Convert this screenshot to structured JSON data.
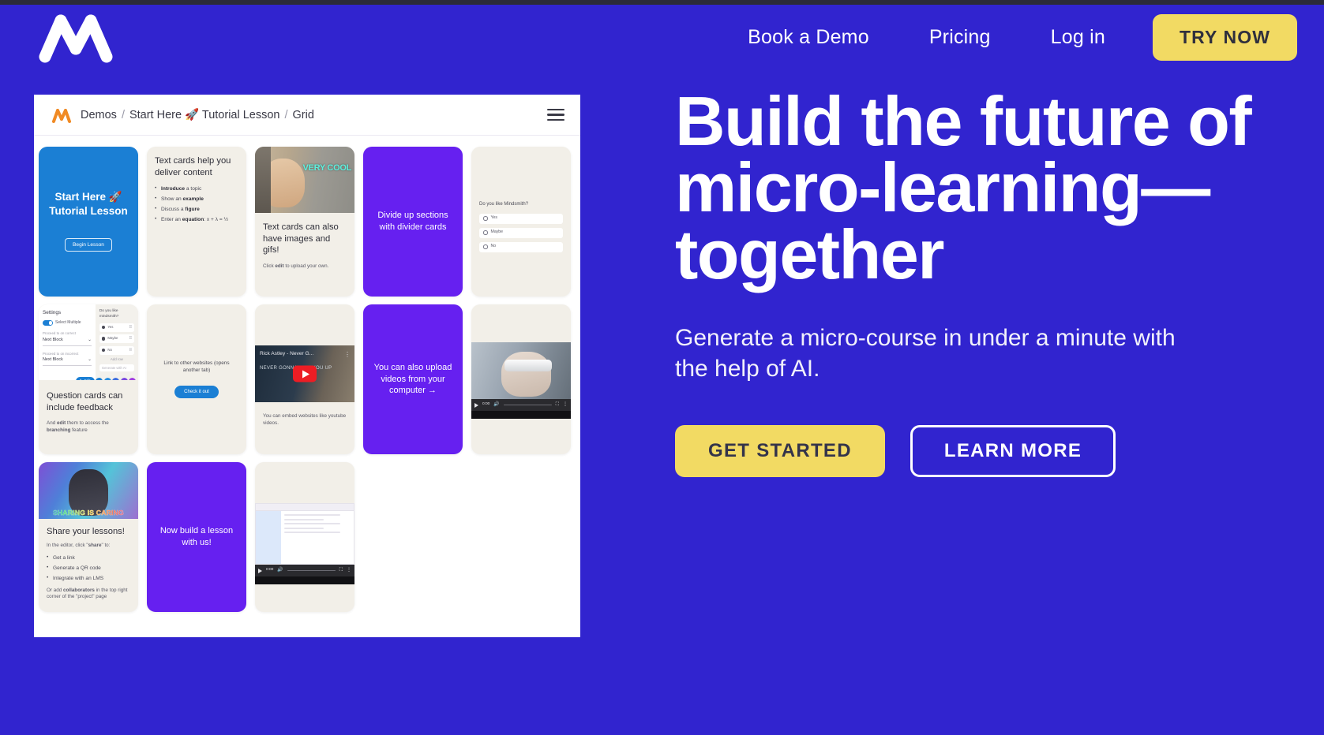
{
  "nav": {
    "logo": "mindsmith-logo",
    "links": [
      {
        "label": "Book a Demo"
      },
      {
        "label": "Pricing"
      },
      {
        "label": "Log in"
      }
    ],
    "cta": "TRY NOW"
  },
  "hero": {
    "title": "Build the future of micro-learning—together",
    "subtitle": "Generate a micro-course in under a minute with the help of AI.",
    "primary_cta": "GET STARTED",
    "secondary_cta": "LEARN MORE"
  },
  "colors": {
    "background": "#3124cf",
    "accent_yellow": "#f2da63",
    "card_purple": "#6620f0",
    "card_blue": "#1b7fd4",
    "card_cream": "#f2efe8",
    "logo_orange": "#f08a24"
  },
  "app": {
    "breadcrumb": {
      "items": [
        "Demos",
        "Start Here 🚀 Tutorial Lesson",
        "Grid"
      ],
      "separator": "/"
    },
    "menu_icon": "hamburger-icon",
    "cards": [
      {
        "id": "start-here",
        "type": "blue",
        "title": "Start Here 🚀 Tutorial Lesson",
        "button": "Begin Lesson"
      },
      {
        "id": "text-cards",
        "type": "text",
        "heading": "Text cards help you deliver content",
        "bullets": [
          {
            "bold": "Introduce",
            "rest": " a topic"
          },
          {
            "pre": "Show an ",
            "bold": "example",
            "rest": ""
          },
          {
            "pre": "Discuss a ",
            "bold": "figure",
            "rest": ""
          },
          {
            "pre": "Enter an ",
            "bold": "equation",
            "rest": ": x + λ = ½"
          }
        ]
      },
      {
        "id": "image-gif-card",
        "type": "image-text",
        "image_caption": "VERY COOL",
        "heading": "Text cards can also have images and gifs!",
        "note_pre": "Click ",
        "note_bold": "edit",
        "note_post": " to upload your own."
      },
      {
        "id": "divider-card",
        "type": "divider",
        "text": "Divide up sections with divider cards"
      },
      {
        "id": "quiz-card",
        "type": "quiz",
        "question": "Do you like Mindsmith?",
        "options": [
          "Yes",
          "Maybe",
          "No"
        ]
      },
      {
        "id": "question-feedback",
        "type": "settings-shot",
        "settings_title": "Settings",
        "toggle_label": "Select Multiple",
        "field1_label": "Proceed to on correct",
        "field1_value": "Next Block",
        "field2_label": "Proceed to on incorrect",
        "field2_value": "Next Block",
        "panel_question": "Do you like mindsmith?",
        "panel_options": [
          "Yes",
          "Maybe",
          "No"
        ],
        "panel_add": "Add row",
        "panel_input": "Generate with AI",
        "toolbar_label": "Edit",
        "heading": "Question cards can include feedback",
        "note_pre": "And ",
        "note_bold": "edit",
        "note_mid": " them to access the ",
        "note_bold2": "branching",
        "note_post": " feature"
      },
      {
        "id": "link-card",
        "type": "link",
        "text": "Link to other websites (opens another tab)",
        "button": "Check it out"
      },
      {
        "id": "youtube-embed",
        "type": "youtube",
        "video_title": "Rick Astley - Never G...",
        "video_overlay": "NEVER GONNA GIVE YOU UP",
        "caption": "You can embed websites like youtube videos."
      },
      {
        "id": "upload-video-divider",
        "type": "divider",
        "text": "You can also upload videos from your computer →"
      },
      {
        "id": "vr-video",
        "type": "video",
        "time": "0:00"
      },
      {
        "id": "share-lessons",
        "type": "share",
        "image_caption": "SHARING IS CARING",
        "heading": "Share your lessons!",
        "intro_pre": "In the editor, click \"",
        "intro_bold": "share",
        "intro_post": "\" to:",
        "bullets": [
          "Get a link",
          "Generate a QR code",
          "Integrate with an LMS"
        ],
        "footer_pre": "Or add ",
        "footer_bold": "collaborators",
        "footer_post": " in the top right corner of the \"project\" page"
      },
      {
        "id": "build-lesson-divider",
        "type": "divider",
        "text": "Now build a lesson with us!"
      },
      {
        "id": "doc-video",
        "type": "video",
        "time": "0:00"
      }
    ]
  }
}
